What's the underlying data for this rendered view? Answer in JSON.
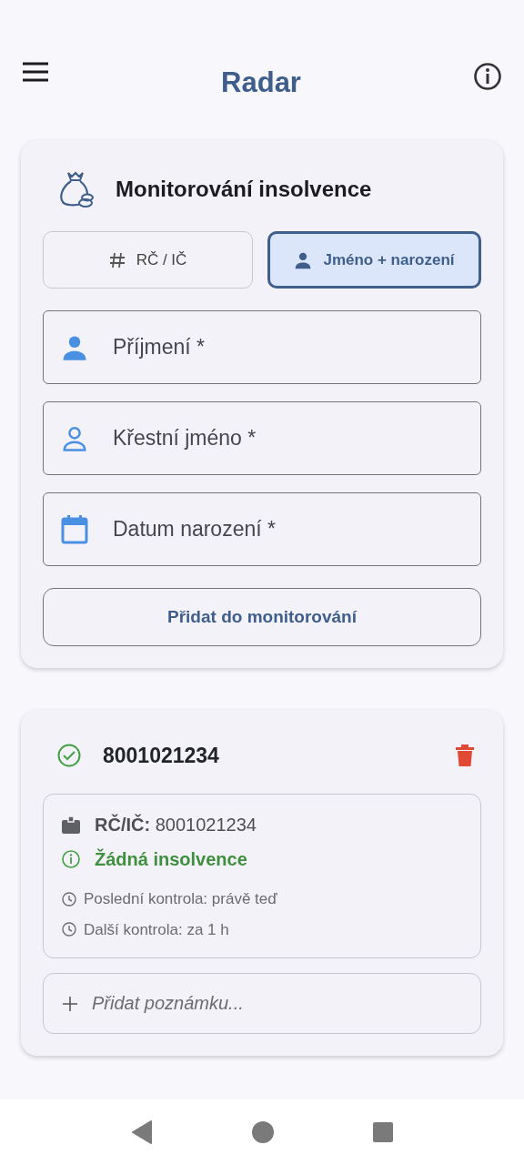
{
  "app_bar": {
    "title": "Radar"
  },
  "form_card": {
    "title": "Monitorování insolvence",
    "modes": [
      {
        "label": "RČ / IČ",
        "kind": "number",
        "selected": false
      },
      {
        "label": "Jméno + narození",
        "kind": "name",
        "selected": true
      }
    ],
    "fields": [
      {
        "placeholder": "Příjmení *",
        "kind": "surname"
      },
      {
        "placeholder": "Křestní jméno *",
        "kind": "firstname"
      },
      {
        "placeholder": "Datum narození *",
        "kind": "date"
      }
    ],
    "submit": "Přidat do monitorování"
  },
  "entries": [
    {
      "title": "8001021234",
      "ok": true,
      "id_line": "**RČ/IČ:** 8001021234",
      "status": "Žádná insolvence",
      "checks": [
        "Poslední kontrola: právě teď",
        "Další kontrola: za 1 h"
      ],
      "note": {
        "placeholder": "Přidat poznámku..."
      }
    }
  ]
}
